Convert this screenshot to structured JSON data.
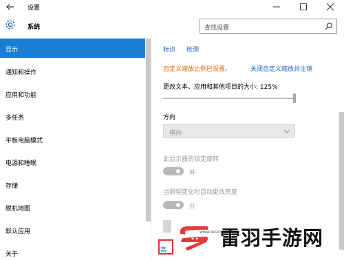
{
  "window": {
    "title": "设置"
  },
  "header": {
    "section_title": "系统",
    "search_placeholder": "查找设置"
  },
  "sidebar": {
    "items": [
      {
        "label": "显示",
        "active": true
      },
      {
        "label": "通知和操作",
        "active": false
      },
      {
        "label": "应用和功能",
        "active": false
      },
      {
        "label": "多任务",
        "active": false
      },
      {
        "label": "平板电脑模式",
        "active": false
      },
      {
        "label": "电源和睡眠",
        "active": false
      },
      {
        "label": "存储",
        "active": false
      },
      {
        "label": "脱机地图",
        "active": false
      },
      {
        "label": "默认应用",
        "active": false
      },
      {
        "label": "关于",
        "active": false
      }
    ]
  },
  "content": {
    "identify_link": "标识",
    "detect_link": "检测",
    "custom_scale_notice": "自定义缩放比例已设置。",
    "turn_off_custom_scale_link": "关闭自定义缩放并注销",
    "size_label": "更改文本、应用和其他项目的大小: 125%",
    "size_percent": 125,
    "orientation_label": "方向",
    "orientation_value": "横向",
    "lock_rotation_label": "此显示器的锁定旋转",
    "lock_rotation_state": "开",
    "auto_brightness_label": "当照明变化时自动更改亮度",
    "auto_brightness_state": "开",
    "advanced_link_partial": "高"
  },
  "watermark": {
    "url": "www.leiucn.com",
    "name": "雷羽手游网"
  },
  "colors": {
    "accent": "#1a7fd4",
    "link": "#1a62b5",
    "warning": "#e26b00",
    "highlight": "#e03030"
  }
}
